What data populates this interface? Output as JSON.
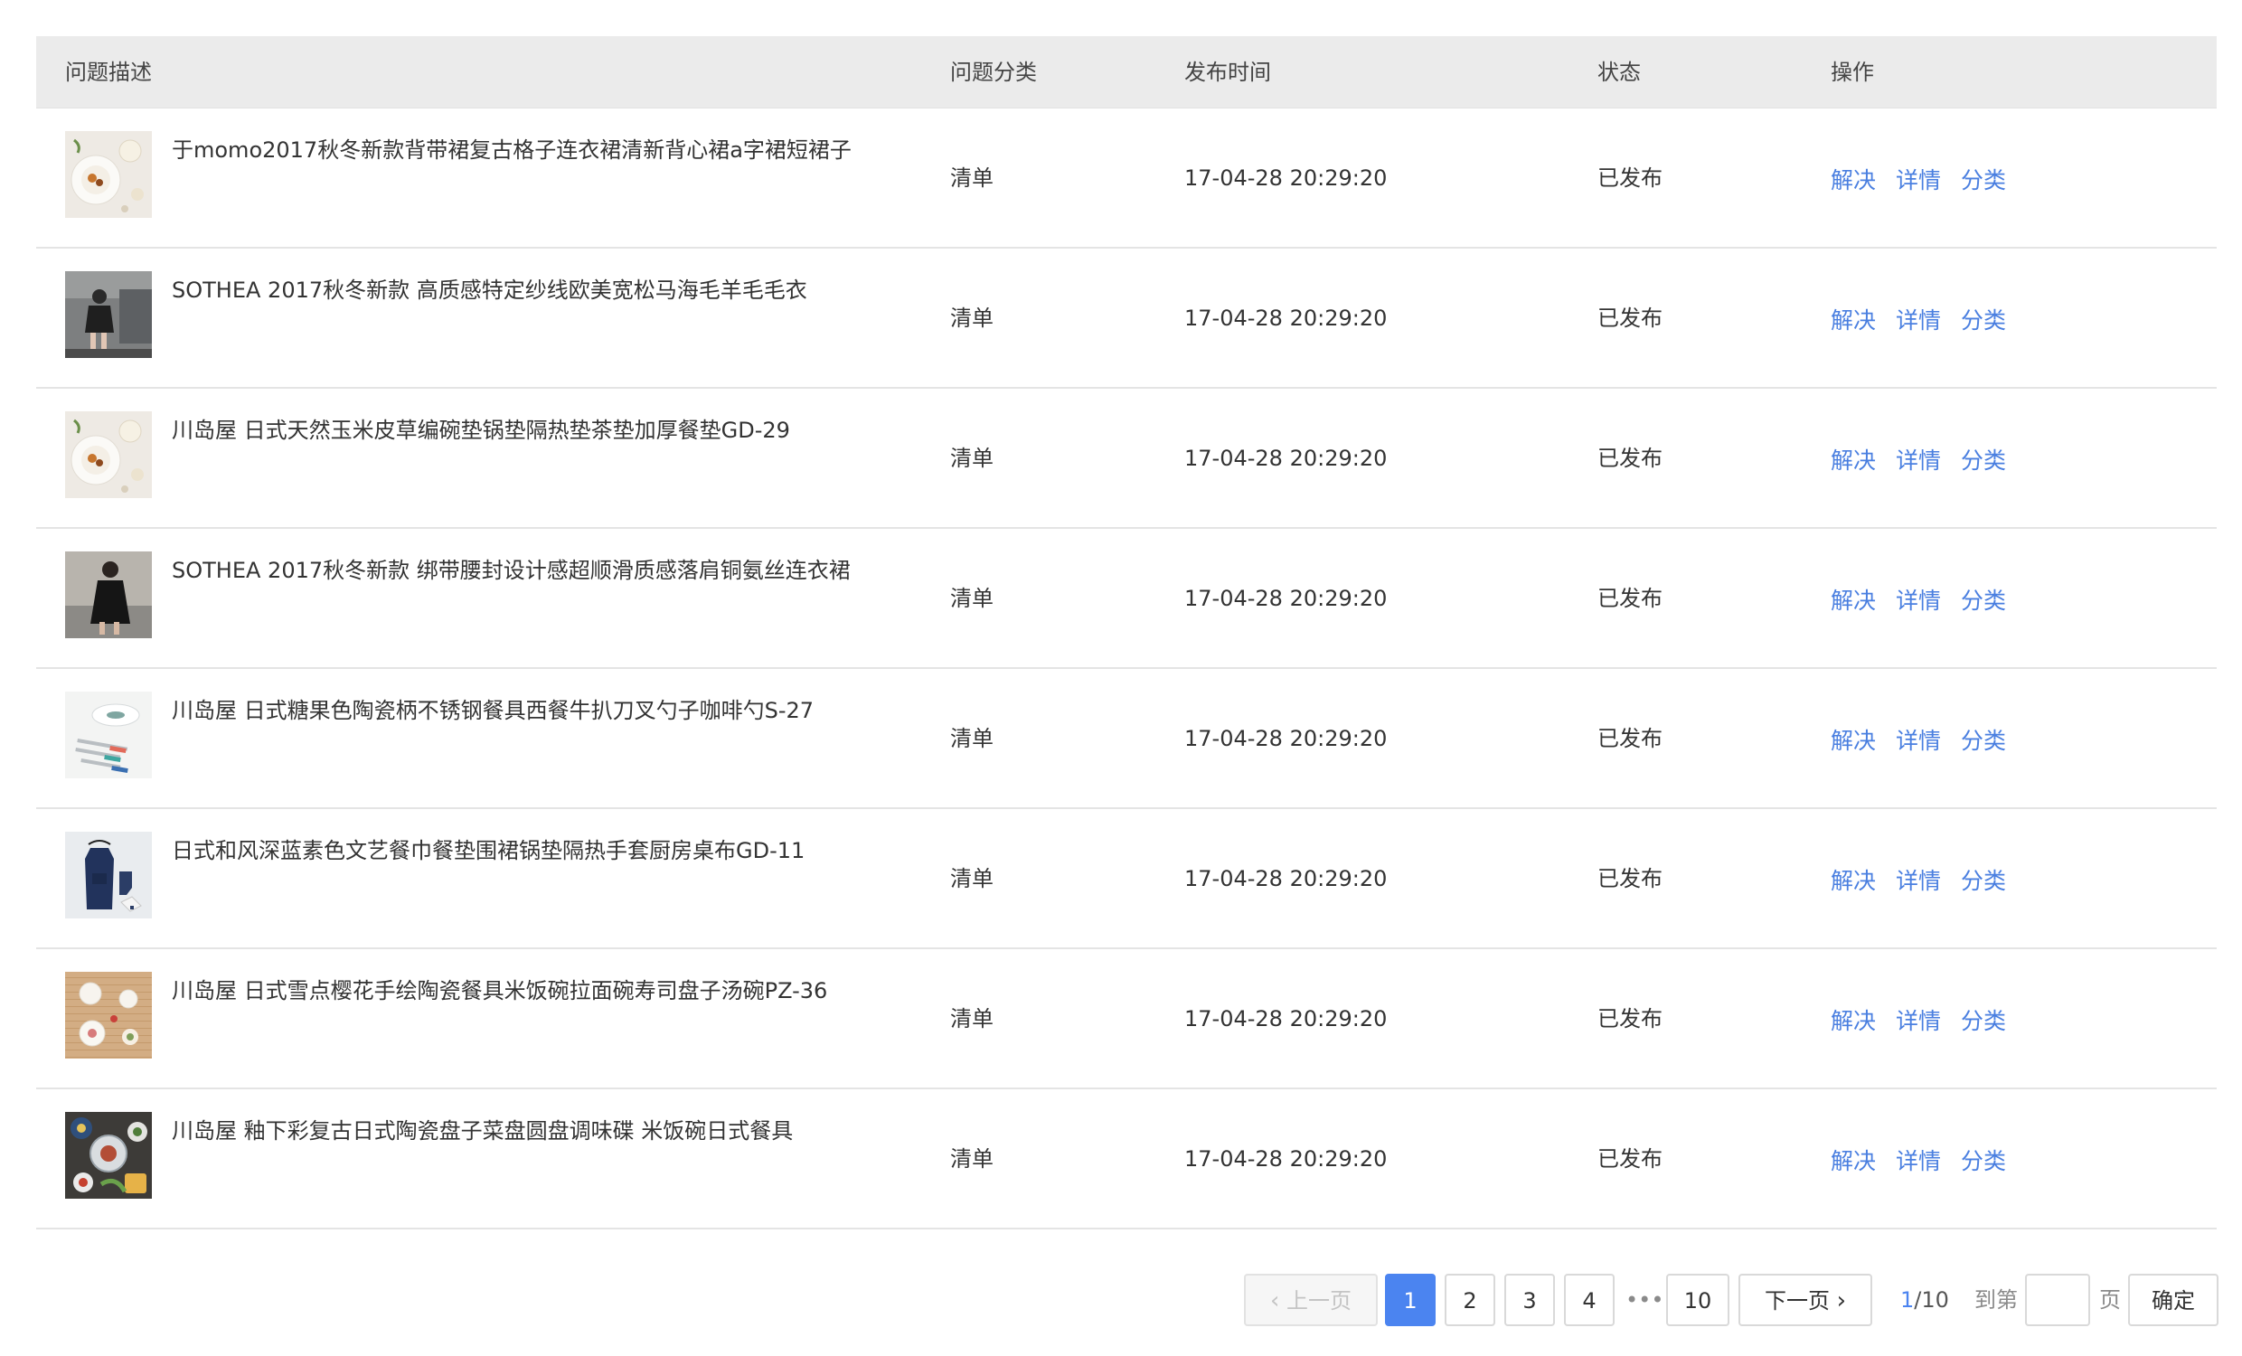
{
  "table": {
    "headers": {
      "description": "问题描述",
      "category": "问题分类",
      "time": "发布时间",
      "status": "状态",
      "actions": "操作"
    },
    "action_labels": {
      "resolve": "解决",
      "detail": "详情",
      "classify": "分类"
    },
    "rows": [
      {
        "title": "于momo2017秋冬新款背带裙复古格子连衣裙清新背心裙a字裙短裙子",
        "category": "清单",
        "time": "17-04-28 20:29:20",
        "status": "已发布",
        "thumb_icon": "tableware-photo"
      },
      {
        "title": "SOTHEA 2017秋冬新款 高质感特定纱线欧美宽松马海毛羊毛毛衣",
        "category": "清单",
        "time": "17-04-28 20:29:20",
        "status": "已发布",
        "thumb_icon": "fashion-photo"
      },
      {
        "title": "川岛屋 日式天然玉米皮草编碗垫锅垫隔热垫茶垫加厚餐垫GD-29",
        "category": "清单",
        "time": "17-04-28 20:29:20",
        "status": "已发布",
        "thumb_icon": "tableware-photo"
      },
      {
        "title": "SOTHEA 2017秋冬新款 绑带腰封设计感超顺滑质感落肩铜氨丝连衣裙",
        "category": "清单",
        "time": "17-04-28 20:29:20",
        "status": "已发布",
        "thumb_icon": "fashion-photo"
      },
      {
        "title": "川岛屋 日式糖果色陶瓷柄不锈钢餐具西餐牛扒刀叉勺子咖啡勺S-27",
        "category": "清单",
        "time": "17-04-28 20:29:20",
        "status": "已发布",
        "thumb_icon": "cutlery-photo"
      },
      {
        "title": "日式和风深蓝素色文艺餐巾餐垫围裙锅垫隔热手套厨房桌布GD-11",
        "category": "清单",
        "time": "17-04-28 20:29:20",
        "status": "已发布",
        "thumb_icon": "apron-photo"
      },
      {
        "title": "川岛屋 日式雪点樱花手绘陶瓷餐具米饭碗拉面碗寿司盘子汤碗PZ-36",
        "category": "清单",
        "time": "17-04-28 20:29:20",
        "status": "已发布",
        "thumb_icon": "dishes-photo"
      },
      {
        "title": "川岛屋 釉下彩复古日式陶瓷盘子菜盘圆盘调味碟 米饭碗日式餐具",
        "category": "清单",
        "time": "17-04-28 20:29:20",
        "status": "已发布",
        "thumb_icon": "plates-photo"
      }
    ]
  },
  "pagination": {
    "prev_label": "上一页",
    "next_label": "下一页",
    "pages": [
      "1",
      "2",
      "3",
      "4"
    ],
    "ellipsis": "•••",
    "last_page": "10",
    "current_page": "1",
    "page_total_sep": "/10",
    "goto_label": "到第",
    "page_unit": "页",
    "goto_value": "",
    "confirm_label": "确定"
  },
  "colors": {
    "accent": "#4b84f0",
    "link": "#4a7fe0",
    "header_bg": "#ebebeb"
  }
}
